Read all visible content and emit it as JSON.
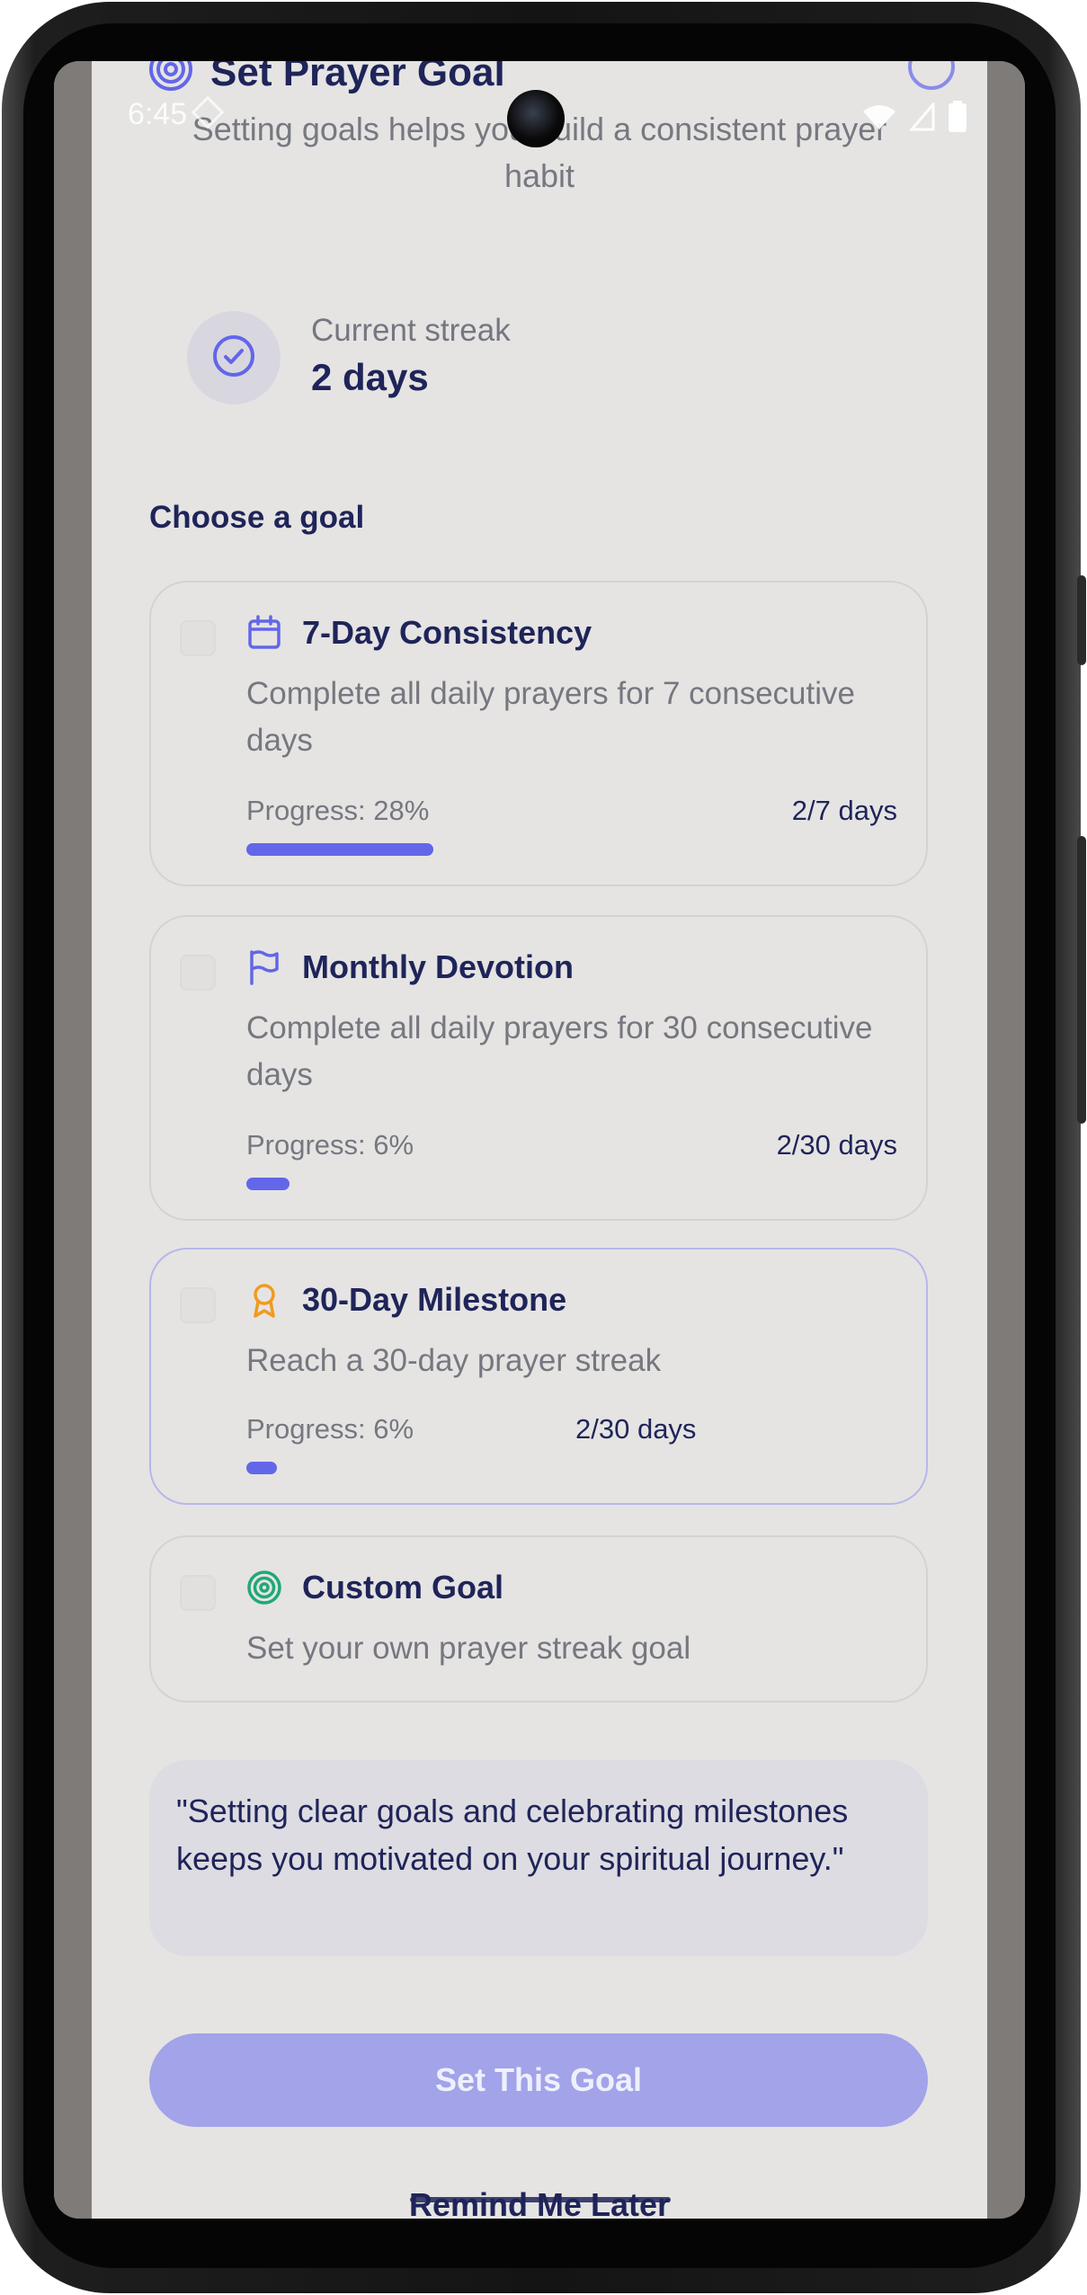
{
  "status_bar": {
    "time": "6:45"
  },
  "header": {
    "title": "Set Prayer Goal",
    "subtitle": "Setting goals helps you build a consistent prayer habit"
  },
  "streak": {
    "label": "Current streak",
    "value": "2 days"
  },
  "section_title": "Choose a goal",
  "goals": [
    {
      "icon": "calendar-icon",
      "title": "7-Day Consistency",
      "description": "Complete all daily prayers for 7 consecutive days",
      "progress_label": "Progress: 28%",
      "progress_value": 0.28,
      "days": "2/7 days"
    },
    {
      "icon": "flag-icon",
      "title": "Monthly Devotion",
      "description": "Complete all daily prayers for 30 consecutive days",
      "progress_label": "Progress: 6%",
      "progress_value": 0.06,
      "days": "2/30 days"
    },
    {
      "icon": "award-icon",
      "title": "30-Day Milestone",
      "description": "Reach a 30-day prayer streak",
      "progress_label": "Progress: 6%",
      "progress_value": 0.06,
      "days": "2/30 days"
    },
    {
      "icon": "target-icon",
      "title": "Custom Goal",
      "description": "Set your own prayer streak goal"
    }
  ],
  "quote": "\"Setting clear goals and celebrating milestones keeps you motivated on your spiritual journey.\"",
  "actions": {
    "primary": "Set This Goal",
    "secondary": "Remind Me Later"
  },
  "colors": {
    "accent": "#6366E8",
    "accent_disabled": "#A2A3E8",
    "title_text": "#1F2459",
    "muted_text": "#76777F",
    "award": "#F29A1B",
    "custom_target": "#1FA878"
  }
}
